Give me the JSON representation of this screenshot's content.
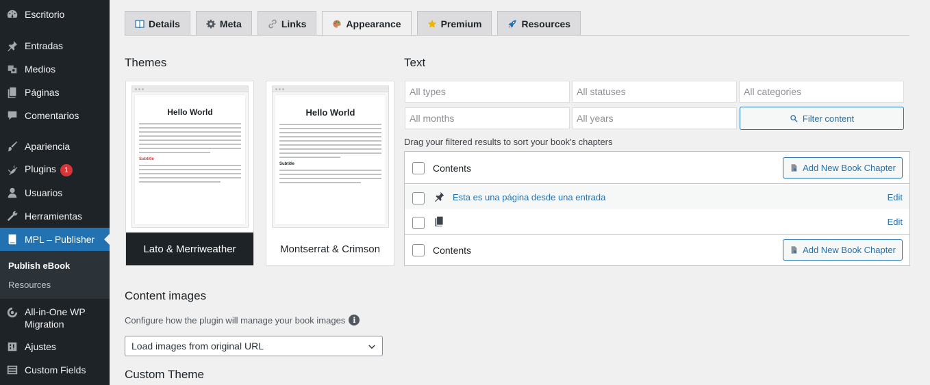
{
  "sidebar": {
    "items": [
      {
        "label": "Escritorio",
        "icon": "dashboard-icon"
      },
      {
        "label": "Entradas",
        "icon": "pin-icon"
      },
      {
        "label": "Medios",
        "icon": "media-icon"
      },
      {
        "label": "Páginas",
        "icon": "page-icon"
      },
      {
        "label": "Comentarios",
        "icon": "comment-icon"
      },
      {
        "label": "Apariencia",
        "icon": "brush-icon"
      },
      {
        "label": "Plugins",
        "icon": "plugin-icon",
        "badge": "1"
      },
      {
        "label": "Usuarios",
        "icon": "users-icon"
      },
      {
        "label": "Herramientas",
        "icon": "wrench-icon"
      },
      {
        "label": "MPL – Publisher",
        "icon": "book-icon",
        "active": true
      },
      {
        "label": "All-in-One WP Migration",
        "icon": "migration-icon"
      },
      {
        "label": "Ajustes",
        "icon": "settings-icon"
      },
      {
        "label": "Custom Fields",
        "icon": "custom-fields-icon"
      }
    ],
    "submenu": [
      {
        "label": "Publish eBook",
        "current": true
      },
      {
        "label": "Resources"
      }
    ]
  },
  "tabs": [
    {
      "label": "Details",
      "icon": "book-open-icon"
    },
    {
      "label": "Meta",
      "icon": "gear-icon"
    },
    {
      "label": "Links",
      "icon": "link-icon"
    },
    {
      "label": "Appearance",
      "icon": "palette-icon",
      "active": true
    },
    {
      "label": "Premium",
      "icon": "star-icon"
    },
    {
      "label": "Resources",
      "icon": "rocket-icon"
    }
  ],
  "themes": {
    "heading": "Themes",
    "cards": [
      {
        "name": "Lato & Merriweather",
        "preview_title": "Hello World",
        "preview_subtitle": "Subtitle",
        "selected": true
      },
      {
        "name": "Montserrat & Crimson",
        "preview_title": "Hello World",
        "preview_subtitle": "Subtitle",
        "selected": false
      }
    ]
  },
  "text": {
    "heading": "Text",
    "filters": {
      "types_placeholder": "All types",
      "statuses_placeholder": "All statuses",
      "categories_placeholder": "All categories",
      "months_placeholder": "All months",
      "years_placeholder": "All years",
      "filter_button": "Filter content"
    },
    "drag_hint": "Drag your filtered results to sort your book's chapters",
    "chapters": {
      "header_label": "Contents",
      "add_button": "Add New Book Chapter",
      "rows": [
        {
          "title": "Esta es una página desde una entrada",
          "icon": "pin-icon",
          "edit": "Edit"
        },
        {
          "title": "",
          "icon": "pages-icon",
          "edit": "Edit"
        }
      ],
      "footer_label": "Contents",
      "footer_add_button": "Add New Book Chapter"
    }
  },
  "content_images": {
    "heading": "Content images",
    "description": "Configure how the plugin will manage your book images",
    "select_value": "Load images from original URL"
  },
  "custom_theme": {
    "heading": "Custom Theme"
  }
}
